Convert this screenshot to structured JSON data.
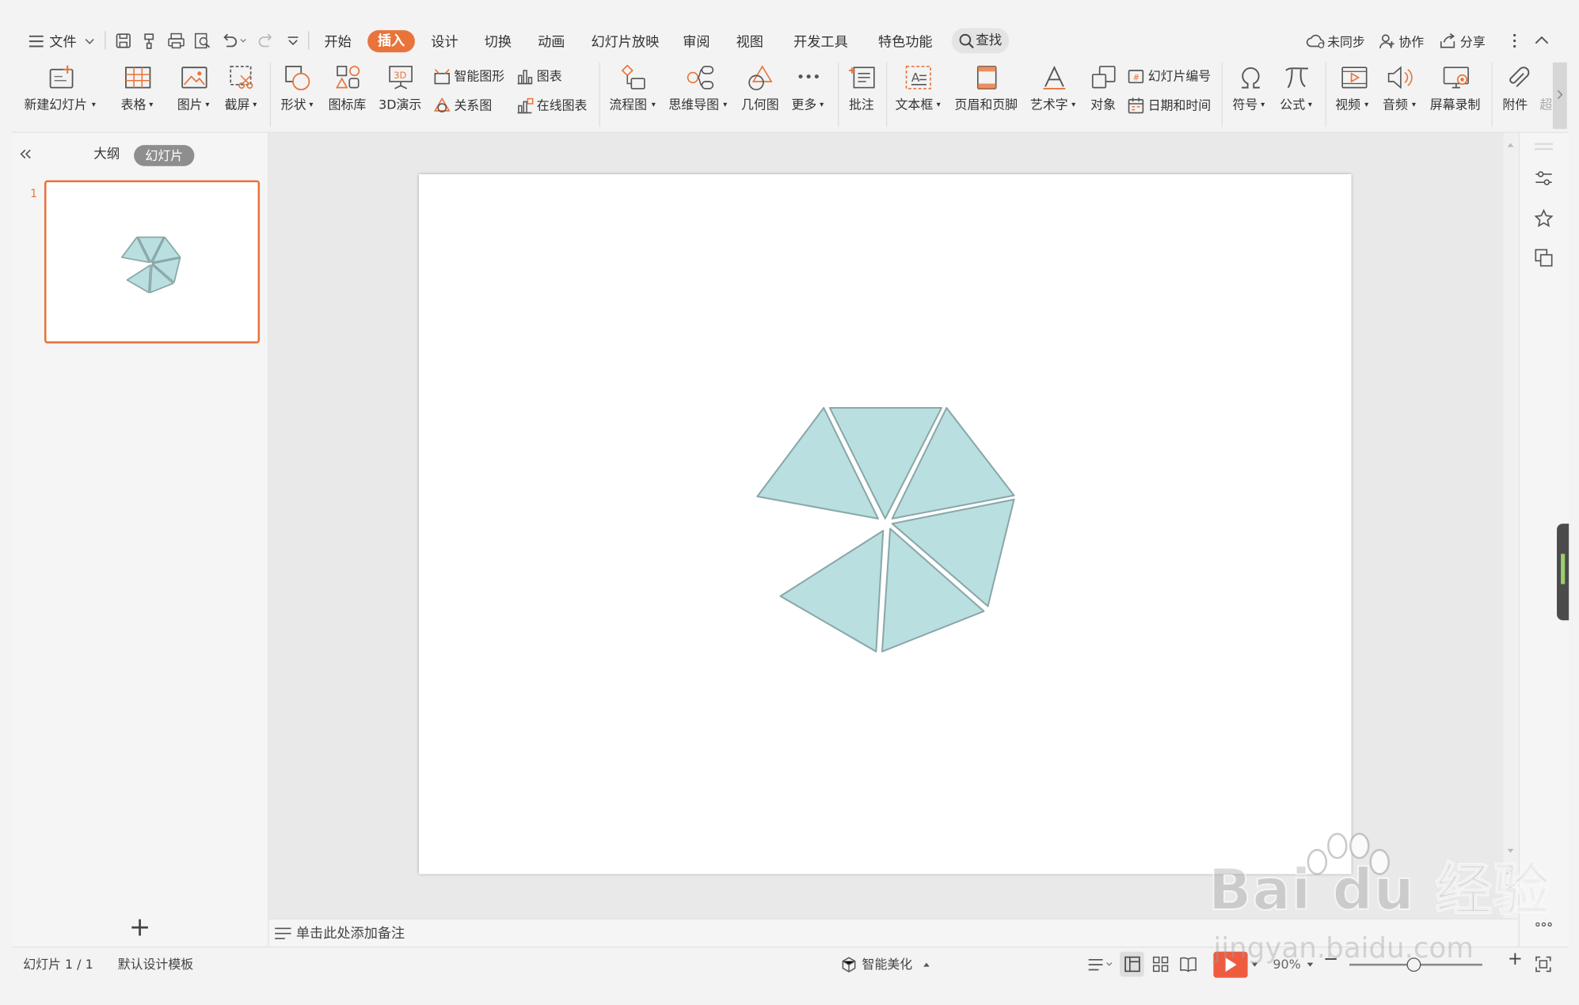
{
  "menubar": {
    "file_label": "文件",
    "tabs": [
      {
        "label": "开始",
        "active": false
      },
      {
        "label": "插入",
        "active": true
      },
      {
        "label": "设计",
        "active": false
      },
      {
        "label": "切换",
        "active": false
      },
      {
        "label": "动画",
        "active": false
      },
      {
        "label": "幻灯片放映",
        "active": false
      },
      {
        "label": "审阅",
        "active": false
      },
      {
        "label": "视图",
        "active": false
      },
      {
        "label": "开发工具",
        "active": false
      },
      {
        "label": "特色功能",
        "active": false
      }
    ],
    "search_label": "查找",
    "right": {
      "sync_label": "未同步",
      "collab_label": "协作",
      "share_label": "分享"
    }
  },
  "ribbon": {
    "new_slide": "新建幻灯片",
    "table": "表格",
    "picture": "图片",
    "screenshot": "截屏",
    "shape": "形状",
    "icon_lib": "图标库",
    "demo_3d": "3D演示",
    "smart_art": "智能图形",
    "chart": "图表",
    "relation": "关系图",
    "online_chart": "在线图表",
    "flowchart": "流程图",
    "mindmap": "思维导图",
    "geometry": "几何图",
    "more": "更多",
    "comment": "批注",
    "textbox": "文本框",
    "header_footer": "页眉和页脚",
    "wordart": "艺术字",
    "object": "对象",
    "slide_number": "幻灯片编号",
    "date_time": "日期和时间",
    "symbol": "符号",
    "formula": "公式",
    "video": "视频",
    "audio": "音频",
    "screen_record": "屏幕录制",
    "attachment": "附件",
    "hyperlink_partial": "超"
  },
  "left_panel": {
    "tab_outline": "大纲",
    "tab_slides": "幻灯片",
    "slide_number": "1"
  },
  "notes": {
    "placeholder": "单击此处添加备注"
  },
  "statusbar": {
    "slide_counter": "幻灯片 1 / 1",
    "template": "默认设计模板",
    "beautify": "智能美化",
    "zoom": "90%"
  },
  "watermark": {
    "brand": "Bai du 经验",
    "url": "jingyan.baidu.com"
  },
  "slide_content": {
    "shape_fill": "#b9dfe0",
    "shape_stroke": "#8aa7a8"
  },
  "colors": {
    "accent": "#e8743b",
    "play": "#ef5b3f"
  }
}
